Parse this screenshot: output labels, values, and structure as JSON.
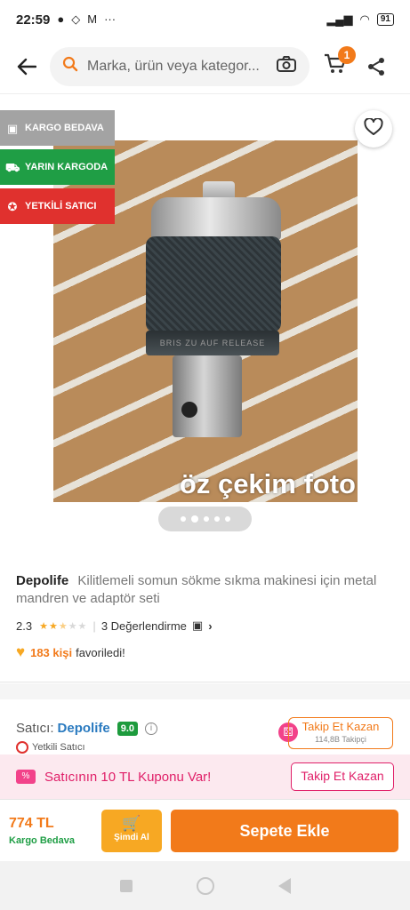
{
  "status_bar": {
    "time": "22:59",
    "battery": "91"
  },
  "search": {
    "placeholder": "Marka, ürün veya kategor...",
    "cart_count": "1"
  },
  "gallery": {
    "tags": [
      {
        "label": "KARGO BEDAVA",
        "icon": "box-icon"
      },
      {
        "label": "YARIN KARGODA",
        "icon": "truck-icon"
      },
      {
        "label": "YETKİLİ SATICI",
        "icon": "badge-icon"
      }
    ],
    "photo_caption": "öz çekim foto",
    "chuck_text": "BRIS ZU AUF RELEASE",
    "image_index": 2,
    "image_count": 5
  },
  "product": {
    "brand": "Depolife",
    "title": "Kilitlemeli somun sökme sıkma makinesi için metal mandren ve adaptör seti",
    "rating": "2.3",
    "rating_value": 2.3,
    "reviews": "3 Değerlendirme",
    "fav_count": "183 kişi",
    "fav_text": "favoriledi!"
  },
  "seller": {
    "label": "Satıcı:",
    "name": "Depolife",
    "score": "9.0",
    "authorized": "Yetkili Satıcı",
    "follow_label": "Takip Et Kazan",
    "followers": "114,8B Takipçi"
  },
  "coupon": {
    "text": "Satıcının 10 TL Kuponu Var!",
    "button": "Takip Et Kazan"
  },
  "buy": {
    "price": "774 TL",
    "shipping": "Kargo Bedava",
    "buy_now": "Şimdi Al",
    "add_to_cart": "Sepete Ekle"
  },
  "colors": {
    "accent": "#f27a1a",
    "green": "#1f9e45",
    "red": "#e0312e",
    "pink": "#e01f68"
  }
}
